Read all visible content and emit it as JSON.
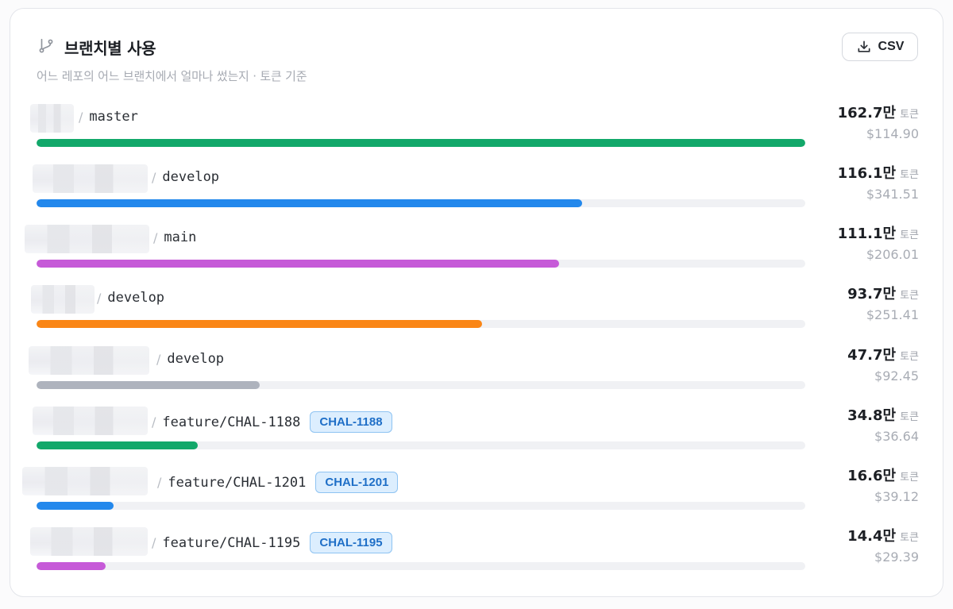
{
  "header": {
    "title": "브랜치별 사용",
    "subtitle": "어느 레포의 어느 브랜치에서 얼마나 썼는지 · 토큰 기준",
    "csv_label": "CSV"
  },
  "token_unit": "토큰",
  "rows": [
    {
      "branch": "master",
      "ticket": "",
      "tokens": "162.7만",
      "cost": "$114.90",
      "share": 1.0,
      "color": "#12a86a"
    },
    {
      "branch": "develop",
      "ticket": "",
      "tokens": "116.1만",
      "cost": "$341.51",
      "share": 0.71,
      "color": "#2388ec"
    },
    {
      "branch": "main",
      "ticket": "",
      "tokens": "111.1만",
      "cost": "$206.01",
      "share": 0.68,
      "color": "#c65ad8"
    },
    {
      "branch": "develop",
      "ticket": "",
      "tokens": "93.7만",
      "cost": "$251.41",
      "share": 0.58,
      "color": "#fa8616"
    },
    {
      "branch": "develop",
      "ticket": "",
      "tokens": "47.7만",
      "cost": "$92.45",
      "share": 0.29,
      "color": "#aeb3bd"
    },
    {
      "branch": "feature/CHAL-1188",
      "ticket": "CHAL-1188",
      "tokens": "34.8만",
      "cost": "$36.64",
      "share": 0.21,
      "color": "#12a86a"
    },
    {
      "branch": "feature/CHAL-1201",
      "ticket": "CHAL-1201",
      "tokens": "16.6만",
      "cost": "$39.12",
      "share": 0.1,
      "color": "#2388ec"
    },
    {
      "branch": "feature/CHAL-1195",
      "ticket": "CHAL-1195",
      "tokens": "14.4만",
      "cost": "$29.39",
      "share": 0.09,
      "color": "#c65ad8"
    }
  ]
}
